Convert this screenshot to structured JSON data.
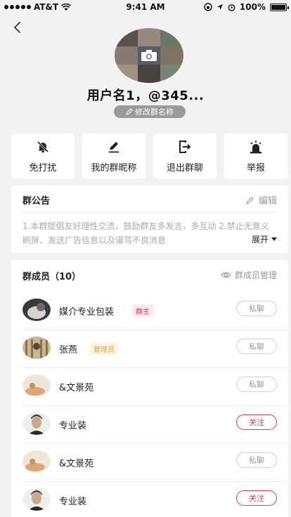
{
  "status_bar": {
    "carrier": "AT&T",
    "time": "9:41 AM",
    "battery": "100%"
  },
  "header": {
    "group_name": "用户名1，@345...",
    "edit_name_label": "修改群名称"
  },
  "actions": [
    {
      "label": "免打扰",
      "icon": "bell-off-icon"
    },
    {
      "label": "我的群昵称",
      "icon": "pencil-icon"
    },
    {
      "label": "退出群聊",
      "icon": "exit-icon"
    },
    {
      "label": "举报",
      "icon": "alarm-icon"
    }
  ],
  "notice": {
    "title": "群公告",
    "edit_label": "编辑",
    "text": "1.本群提倡友好理性交流，鼓励群友多发言，多互动  2.禁止无意义刷屏、发送广告信息以及谩骂不良消息",
    "expand_label": "展开"
  },
  "members": {
    "title": "群成员（10）",
    "manage_label": "群成员管理",
    "list": [
      {
        "name": "媒介专业包装",
        "badge": "群主",
        "badge_type": "owner",
        "button": "私聊",
        "button_type": "chat"
      },
      {
        "name": "张燕",
        "badge": "管理员",
        "badge_type": "admin",
        "button": "私聊",
        "button_type": "chat"
      },
      {
        "name": "&文景苑",
        "badge": "",
        "badge_type": "",
        "button": "私聊",
        "button_type": "chat"
      },
      {
        "name": "专业装",
        "badge": "",
        "badge_type": "",
        "button": "关注",
        "button_type": "follow"
      },
      {
        "name": "&文景苑",
        "badge": "",
        "badge_type": "",
        "button": "私聊",
        "button_type": "chat"
      },
      {
        "name": "专业装",
        "badge": "",
        "badge_type": "",
        "button": "关注",
        "button_type": "follow"
      }
    ]
  },
  "colors": {
    "accent": "#e8385a",
    "admin": "#e3a23b",
    "background": "#f2f2f2"
  }
}
